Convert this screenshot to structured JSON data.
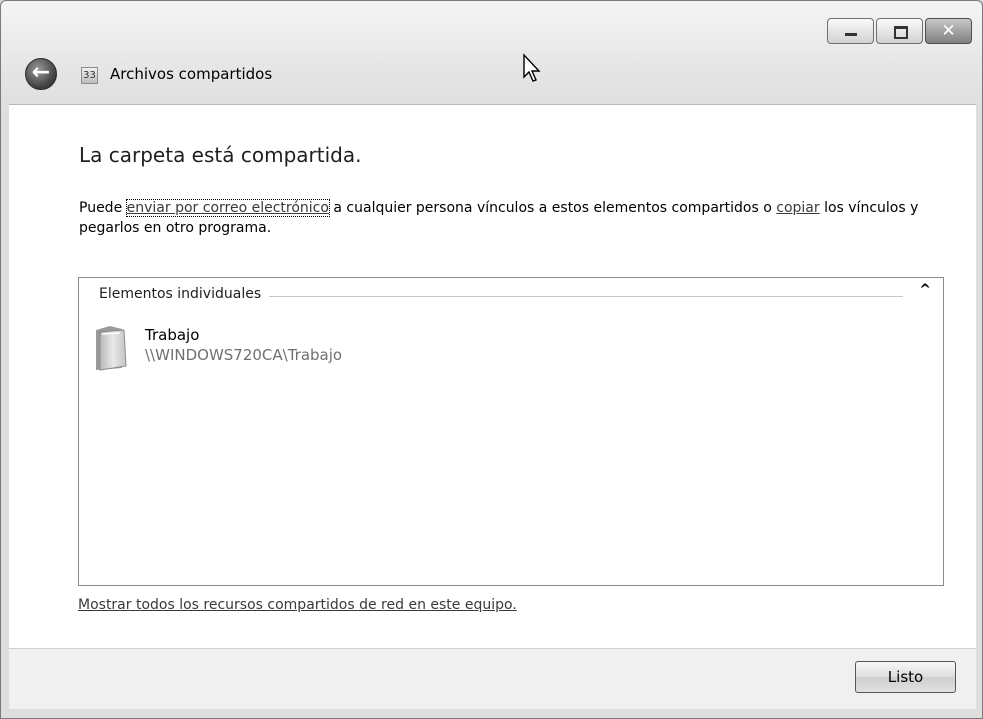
{
  "window": {
    "title": "Archivos compartidos",
    "title_icon_text": "33"
  },
  "caption_buttons": {
    "close_label": "✕"
  },
  "content": {
    "heading": "La carpeta está compartida.",
    "desc_prefix": "Puede ",
    "desc_link_email": "enviar por correo electrónico",
    "desc_middle": " a cualquier persona vínculos a estos elementos compartidos o ",
    "desc_link_copy": "copiar",
    "desc_suffix": " los vínculos y pegarlos en otro programa."
  },
  "group": {
    "header": "Elementos individuales",
    "collapse_glyph": "^",
    "items": [
      {
        "name": "Trabajo",
        "path": "\\\\WINDOWS720CA\\Trabajo"
      }
    ]
  },
  "show_all_link": "Mostrar todos los recursos compartidos de red en este equipo.",
  "footer": {
    "done_label": "Listo"
  }
}
